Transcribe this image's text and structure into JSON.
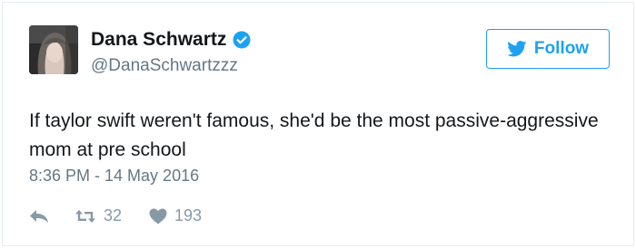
{
  "author": {
    "display_name": "Dana Schwartz",
    "handle": "@DanaSchwartzzz",
    "verified": true
  },
  "follow_button": {
    "label": "Follow"
  },
  "tweet": {
    "text": "If taylor swift weren't famous, she'd be the most passive-aggressive mom at pre school",
    "timestamp": "8:36 PM - 14 May 2016"
  },
  "actions": {
    "retweet_count": "32",
    "like_count": "193"
  },
  "colors": {
    "brand_blue": "#1da1f2",
    "secondary_text": "#657786",
    "icon_gray": "#8899a6"
  }
}
